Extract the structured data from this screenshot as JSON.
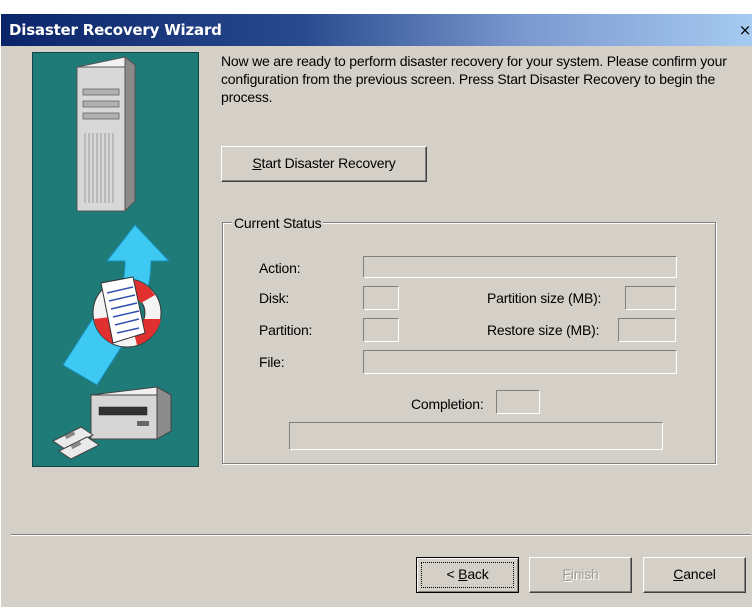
{
  "window": {
    "title": "Disaster Recovery Wizard",
    "close_glyph": "×",
    "titlebar_colors": [
      "#0a246a",
      "#a6caf0"
    ]
  },
  "intro_text": "Now we are ready to perform disaster recovery for your system. Please confirm your configuration from the previous screen. Press Start Disaster Recovery to begin the process.",
  "start_button": {
    "accel": "S",
    "rest": "tart Disaster Recovery"
  },
  "status": {
    "group_label": "Current Status",
    "action_label": "Action:",
    "disk_label": "Disk:",
    "partition_label": "Partition:",
    "file_label": "File:",
    "partition_size_label": "Partition size (MB):",
    "restore_size_label": "Restore size (MB):",
    "completion_label": "Completion:",
    "action_value": "",
    "disk_value": "",
    "partition_value": "",
    "file_value": "",
    "partition_size_value": "",
    "restore_size_value": "",
    "completion_value": ""
  },
  "footer": {
    "back_prefix": "< ",
    "back_accel": "B",
    "back_rest": "ack",
    "finish_accel": "F",
    "finish_rest": "inish",
    "cancel_accel": "C",
    "cancel_rest": "ancel"
  },
  "illustration": {
    "icons": [
      "server-tower-icon",
      "upload-arrow-icon",
      "document-icon",
      "life-ring-icon",
      "floppy-drive-icon",
      "floppy-disk-icon"
    ],
    "panel_color": "#1e7b78",
    "arrow_color": "#33c9f0",
    "ring_color": "#e03030"
  }
}
